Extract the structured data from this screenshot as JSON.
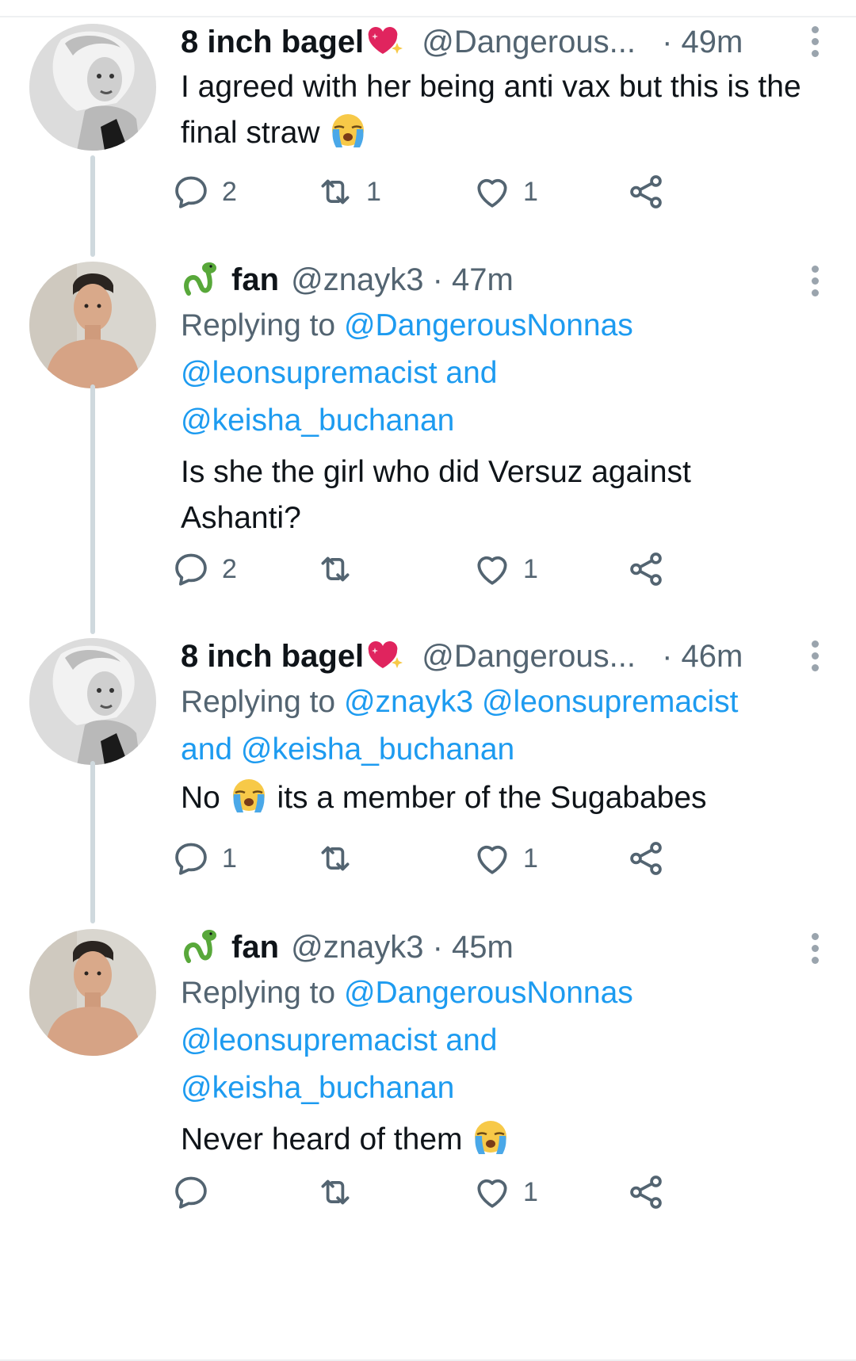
{
  "tweets": [
    {
      "name": "8 inch bagel",
      "handle": "@Dangerous...",
      "dot": "·",
      "time": "49m",
      "text_before_emoji": "I agreed with her being anti vax but this is the final straw ",
      "text_after_emoji": "",
      "replies": "2",
      "retweets": "1",
      "likes": "1"
    },
    {
      "name": "fan",
      "handle": "@znayk3",
      "dot": "·",
      "time": "47m",
      "replying_prefix": "Replying to ",
      "replying_line1": "@DangerousNonnas",
      "replying_line2": "@leonsupremacist and",
      "replying_line3": "@keisha_buchanan",
      "text": "Is she the girl who did Versuz against Ashanti?",
      "replies": "2",
      "retweets": "",
      "likes": "1"
    },
    {
      "name": "8 inch bagel",
      "handle": "@Dangerous...",
      "dot": "·",
      "time": "46m",
      "replying_prefix": "Replying to ",
      "replying_line1": "@znayk3 @leonsupremacist",
      "replying_line2": "and @keisha_buchanan",
      "text_before_emoji": "No ",
      "text_after_emoji": " its a member of the Sugababes",
      "replies": "1",
      "retweets": "",
      "likes": "1"
    },
    {
      "name": "fan",
      "handle": "@znayk3",
      "dot": "·",
      "time": "45m",
      "replying_prefix": "Replying to ",
      "replying_line1": "@DangerousNonnas",
      "replying_line2": "@leonsupremacist and",
      "replying_line3": "@keisha_buchanan",
      "text_before_emoji": "Never heard of them ",
      "replies": "",
      "retweets": "",
      "likes": "1"
    }
  ],
  "icons": {
    "reply": "reply-icon",
    "retweet": "retweet-icon",
    "like": "heart-icon",
    "share": "share-icon",
    "more": "more-options-icon",
    "crying": "loudly-crying-face-icon",
    "heart_badge": "sparkling-heart-icon",
    "snake": "snake-icon"
  },
  "colors": {
    "link": "#1d9bf0",
    "secondary": "#536471",
    "thread_line": "#cfd9de"
  }
}
